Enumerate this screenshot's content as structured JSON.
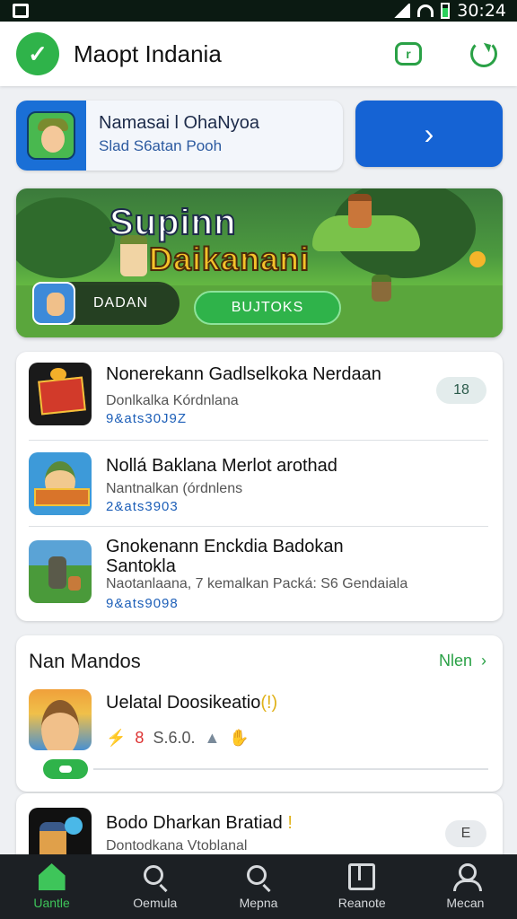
{
  "status_bar": {
    "time": "30:24"
  },
  "app_bar": {
    "title": "Maopt Indania"
  },
  "promo": {
    "title": "Namasai l OhaNyoa",
    "subtitle": "Slad S6atan Pooh",
    "arrow": "›"
  },
  "banner": {
    "title_line1": "Supinn",
    "title_line2": "Daikanani",
    "pill_label": "DADAN",
    "button_label": "BUJTOKS"
  },
  "list": {
    "items": [
      {
        "title": "Nonerekann Gadlselkoka Nerdaan",
        "subtitle": "Donlkalka Kórdnlana",
        "stat": "9&ats30J9Z",
        "badge": "18"
      },
      {
        "title": "Nollá Baklana Merlot arothad",
        "subtitle": "Nantnalkan (órdnlens",
        "stat": "2&ats3903",
        "badge": ""
      },
      {
        "title": "Gnokenann Enckdia Badokan Santokla",
        "subtitle": "Naotanlaana, 7 kemalkan Packá: S6 Gendaiala",
        "stat": "9&ats9098",
        "badge": ""
      }
    ]
  },
  "section": {
    "title": "Nan Mandos",
    "link": "Nlen",
    "item": {
      "title": "Uelatal Doosikeatio",
      "badge_glyph": "(!)",
      "number": "8",
      "rating": "S.6.0."
    }
  },
  "partial": {
    "title": "Bodo Dharkan Bratiad",
    "bang": "!",
    "subtitle": "Dontodkana Vtoblanal",
    "badge": "E"
  },
  "nav": {
    "items": [
      {
        "label": "Uantle"
      },
      {
        "label": "Oemula"
      },
      {
        "label": "Mepna"
      },
      {
        "label": "Reanote"
      },
      {
        "label": "Mecan"
      }
    ]
  }
}
